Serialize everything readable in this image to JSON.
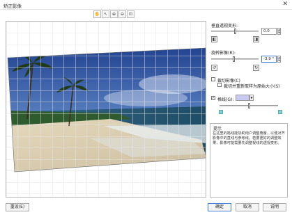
{
  "window": {
    "title": "矫正影像",
    "close_glyph": "✕"
  },
  "toolbar": {
    "tools": [
      {
        "name": "hand-tool-icon",
        "glyph": "✋"
      },
      {
        "name": "pointer-tool-icon",
        "glyph": "↖"
      },
      {
        "name": "zoom-in-icon",
        "glyph": "⊕"
      },
      {
        "name": "zoom-out-icon",
        "glyph": "⊖"
      },
      {
        "name": "fit-view-icon",
        "glyph": "⊡"
      }
    ]
  },
  "panel": {
    "perspective": {
      "label": "垂直透视变形:",
      "value": "0.0"
    },
    "rotate": {
      "label": "旋转影像(R):",
      "value": "-3.9 °"
    },
    "crop": {
      "label": "裁切影像(C)",
      "checked": false
    },
    "crop_resample": {
      "label": "裁切并重新取样为原始大小(S)",
      "checked": false
    },
    "grid": {
      "label": "格线(G):",
      "checked": true,
      "color": "#c9c9f2"
    }
  },
  "hint": {
    "title": "提示",
    "text": "在这里的格线能协助用户调整角度，以便对齐影像中的直线与参考线。若要更好的调整效果，影像可能需要先调整视线的透视变形。"
  },
  "footer": {
    "reset": "重设(E)",
    "ok": "确定",
    "cancel": "取消",
    "help": "说明"
  }
}
